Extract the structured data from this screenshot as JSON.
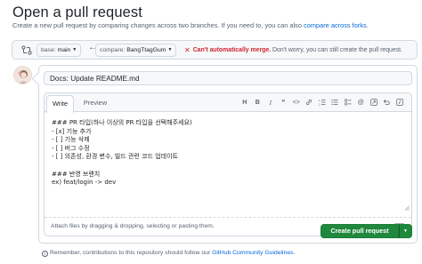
{
  "page": {
    "title": "Open a pull request",
    "subtitle_text": "Create a new pull request by comparing changes across two branches. If you need to, you can also ",
    "subtitle_link": "compare across forks",
    "subtitle_end": "."
  },
  "compare": {
    "base_prefix": "base:",
    "base_branch": "main",
    "compare_prefix": "compare:",
    "compare_branch": "BangTtagGum",
    "status_strong": "Can't automatically merge.",
    "status_rest": " Don't worry, you can still create the pull request."
  },
  "form": {
    "title_value": "Docs: Update README.md",
    "tabs": [
      {
        "label": "Write"
      },
      {
        "label": "Preview"
      }
    ],
    "toolbar": [
      {
        "name": "heading-icon",
        "glyph": "H"
      },
      {
        "name": "bold-icon",
        "glyph": "B"
      },
      {
        "name": "italic-icon",
        "glyph": "I"
      },
      {
        "name": "quote-icon",
        "glyph": "❝"
      },
      {
        "name": "code-icon",
        "glyph": "<>"
      },
      {
        "name": "link-icon",
        "glyph": "🔗"
      },
      {
        "name": "ordered-list-icon",
        "glyph": "≡"
      },
      {
        "name": "unordered-list-icon",
        "glyph": "☰"
      },
      {
        "name": "task-list-icon",
        "glyph": "☑"
      },
      {
        "name": "mention-icon",
        "glyph": "@"
      },
      {
        "name": "reference-icon",
        "glyph": "↗"
      },
      {
        "name": "undo-icon",
        "glyph": "↶"
      },
      {
        "name": "slash-icon",
        "glyph": "∕"
      }
    ],
    "body_lines": [
      "### PR 타입(하나 이상의 PR 타입을 선택해주세요)",
      "- [x] 기능 추가",
      "- [ ] 기능 삭제",
      "- [ ] 버그 수정",
      "- [ ] 의존성, 환경 변수, 빌드 관련 코드 업데이트",
      "",
      "### 반영 브랜치",
      "ex) feat/login -> dev"
    ],
    "attach_text": "Attach files by dragging & dropping, selecting or pasting them.",
    "submit_label": "Create pull request"
  },
  "footer": {
    "text": "Remember, contributions to this repository should follow our ",
    "link": "GitHub Community Guidelines",
    "end": "."
  },
  "colors": {
    "primary_green": "#1f883d",
    "link_blue": "#0969da",
    "danger_red": "#d1242f"
  }
}
